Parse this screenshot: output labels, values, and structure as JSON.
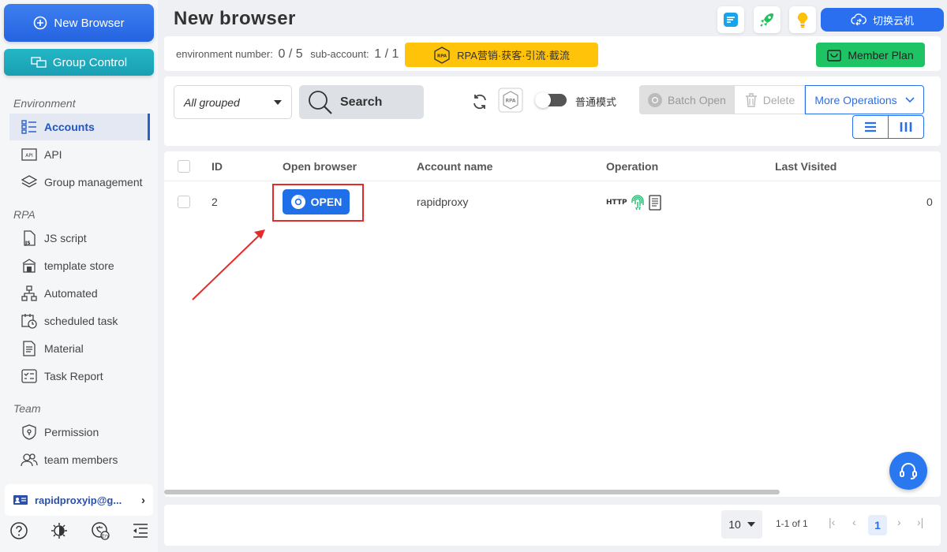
{
  "sidebar": {
    "new_browser_label": "New Browser",
    "group_control_label": "Group Control",
    "sections": {
      "environment": "Environment",
      "rpa": "RPA",
      "team": "Team"
    },
    "items": [
      {
        "label": "Accounts",
        "icon": "list-icon",
        "active": true
      },
      {
        "label": "API",
        "icon": "api-icon"
      },
      {
        "label": "Group management",
        "icon": "layers-icon"
      },
      {
        "label": "JS script",
        "icon": "js-file-icon"
      },
      {
        "label": "template store",
        "icon": "store-icon"
      },
      {
        "label": "Automated",
        "icon": "flow-icon"
      },
      {
        "label": "scheduled task",
        "icon": "calendar-clock-icon"
      },
      {
        "label": "Material",
        "icon": "document-icon"
      },
      {
        "label": "Task Report",
        "icon": "checklist-icon"
      },
      {
        "label": "Permission",
        "icon": "shield-icon"
      },
      {
        "label": "team members",
        "icon": "users-icon"
      }
    ],
    "user_email": "rapidproxyip@g..."
  },
  "header": {
    "title": "New browser",
    "cloud_switch_label": "切换云机"
  },
  "info": {
    "env_label": "environment number:",
    "env_value": "0 / 5",
    "sub_label": "sub-account:",
    "sub_value": "1 / 1",
    "rpa_banner": "RPA营销·获客·引流·截流",
    "member_plan": "Member Plan"
  },
  "toolbar": {
    "group_select": "All grouped",
    "search_label": "Search",
    "mode_label": "普通模式",
    "batch_open": "Batch Open",
    "delete": "Delete",
    "more_ops": "More Operations"
  },
  "table": {
    "columns": [
      "ID",
      "Open browser",
      "Account name",
      "Operation",
      "Last Visited"
    ],
    "rows": [
      {
        "id": "2",
        "open_label": "OPEN",
        "account": "rapidproxy",
        "proxy_type": "HTTP",
        "last_visited_partial": "0"
      }
    ]
  },
  "pagination": {
    "page_size": "10",
    "range": "1-1 of 1",
    "current": "1"
  },
  "colors": {
    "primary": "#2a6ff0",
    "group_control": "#1a9fb3",
    "rpa_banner": "#ffc30a",
    "member": "#1ec463",
    "highlight": "#e52a2a"
  }
}
